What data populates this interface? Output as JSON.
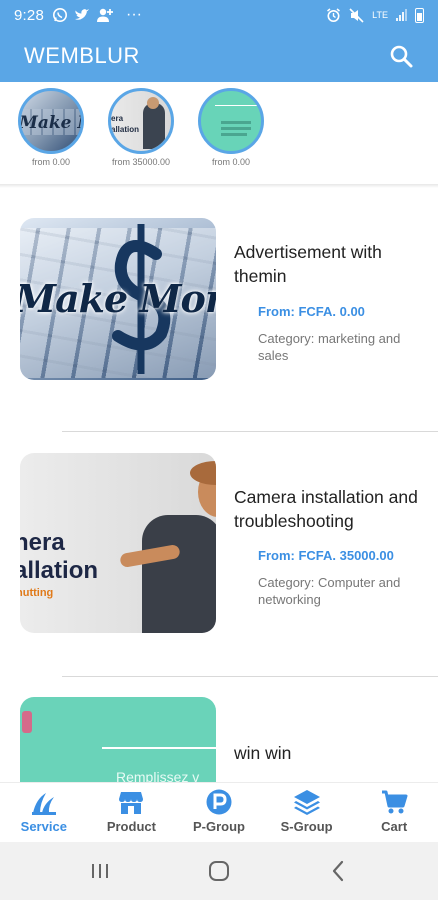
{
  "status_bar": {
    "time": "9:28",
    "network": "LTE",
    "icons": [
      "whatsapp-icon",
      "twitter-icon",
      "add-person-icon",
      "more-dots-icon",
      "alarm-icon",
      "mute-icon",
      "signal-icon",
      "battery-icon"
    ],
    "more": "···"
  },
  "app_bar": {
    "title": "WEMBLUR",
    "search_icon": "search-icon"
  },
  "categories": [
    {
      "price": "from 0.00",
      "thumb_text": "Make Mone"
    },
    {
      "price": "from 35000.00",
      "thumb_text": "era allation"
    },
    {
      "price": "from 0.00",
      "thumb_text": ""
    }
  ],
  "services": [
    {
      "name": "Advertisement with themin",
      "from": "From: FCFA. 0.00",
      "category": "Category: marketing and sales",
      "image_text": "Make Mone"
    },
    {
      "name": "Camera installation and troubleshooting",
      "from": "From: FCFA. 35000.00",
      "category": "Category: Computer and networking",
      "image_text_1": "nera",
      "image_text_2": "allation",
      "image_text_3": "hutting"
    },
    {
      "name": "win win",
      "image_text": "Remplissez v"
    }
  ],
  "bottom_nav": [
    {
      "label": "Service",
      "icon": "service-icon",
      "active": true
    },
    {
      "label": "Product",
      "icon": "store-icon",
      "active": false
    },
    {
      "label": "P-Group",
      "icon": "p-badge-icon",
      "active": false
    },
    {
      "label": "S-Group",
      "icon": "layers-icon",
      "active": false
    },
    {
      "label": "Cart",
      "icon": "cart-icon",
      "active": false
    }
  ],
  "system_nav": [
    "recents-icon",
    "home-icon",
    "back-icon"
  ],
  "colors": {
    "primary": "#5aa6e6",
    "accent": "#3b8fe3",
    "nav_inactive": "#555555"
  }
}
